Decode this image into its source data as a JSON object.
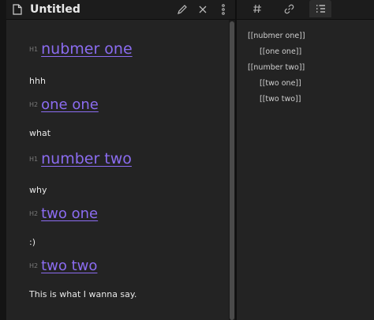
{
  "header": {
    "title": "Untitled"
  },
  "document": {
    "blocks": [
      {
        "type": "heading",
        "level_label": "H1",
        "text": "nubmer one"
      },
      {
        "type": "paragraph",
        "text": "hhh"
      },
      {
        "type": "heading",
        "level_label": "H2",
        "text": "one one"
      },
      {
        "type": "paragraph",
        "text": "what"
      },
      {
        "type": "heading",
        "level_label": "H1",
        "text": "number two"
      },
      {
        "type": "paragraph",
        "text": "why"
      },
      {
        "type": "heading",
        "level_label": "H2",
        "text": "two one"
      },
      {
        "type": "paragraph",
        "text": ":)"
      },
      {
        "type": "heading",
        "level_label": "H2",
        "text": "two two"
      },
      {
        "type": "paragraph",
        "text": "This is what I wanna say."
      }
    ]
  },
  "side_panel": {
    "tabs": [
      {
        "icon": "hashtag-icon",
        "active": false
      },
      {
        "icon": "link-icon",
        "active": false
      },
      {
        "icon": "outline-list-icon",
        "active": true
      }
    ],
    "outline": [
      {
        "text": "[[nubmer one]]",
        "depth": 0
      },
      {
        "text": "[[one one]]",
        "depth": 1
      },
      {
        "text": "[[number two]]",
        "depth": 0
      },
      {
        "text": "[[two one]]",
        "depth": 1
      },
      {
        "text": "[[two two]]",
        "depth": 1
      }
    ]
  },
  "colors": {
    "heading": "#8b6cf0",
    "text": "#e8e8e8",
    "background": "#232323"
  }
}
